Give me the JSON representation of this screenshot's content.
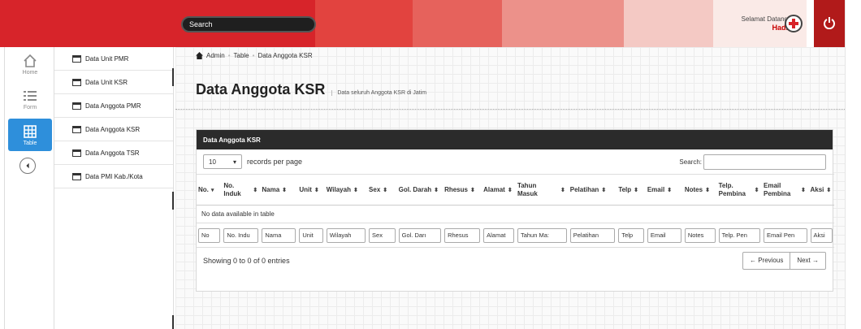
{
  "header": {
    "search_label": "Search",
    "welcome_text": "Selamat Datang",
    "user_name": "Hadi",
    "power_icon": "power-icon",
    "logo_icon": "red-cross-logo-icon"
  },
  "left_nav": {
    "items": [
      {
        "label": "Home",
        "icon": "home-icon"
      },
      {
        "label": "Form",
        "icon": "list-icon"
      },
      {
        "label": "Table",
        "icon": "table-grid-icon"
      }
    ],
    "collapse_icon": "chevron-left-icon"
  },
  "submenu": {
    "items": [
      {
        "label": "Data Unit PMR"
      },
      {
        "label": "Data Unit KSR"
      },
      {
        "label": "Data Anggota PMR"
      },
      {
        "label": "Data Anggota KSR"
      },
      {
        "label": "Data Anggota TSR"
      },
      {
        "label": "Data PMI Kab./Kota"
      }
    ]
  },
  "breadcrumb": {
    "items": [
      "Admin",
      "Table",
      "Data Anggota KSR"
    ]
  },
  "page": {
    "title": "Data Anggota KSR",
    "subtitle": "Data seluruh Anggota KSR di Jatim"
  },
  "panel": {
    "title": "Data Anggota KSR",
    "length_value": "10",
    "length_label": "records per page",
    "search_label": "Search:",
    "columns": [
      "No.",
      "No. Induk",
      "Nama",
      "Unit",
      "Wilayah",
      "Sex",
      "Gol. Darah",
      "Rhesus",
      "Alamat",
      "Tahun Masuk",
      "Pelatihan",
      "Telp",
      "Email",
      "Notes",
      "Telp. Pembina",
      "Email Pembina",
      "Aksi"
    ],
    "empty_text": "No data available in table",
    "filters": [
      "No",
      "No. Indu",
      "Nama",
      "Unit",
      "Wilayah",
      "Sex",
      "Gol. Darı",
      "Rhesus",
      "Alamat",
      "Tahun Ma:",
      "Pelatihan",
      "Telp",
      "Email",
      "Notes",
      "Telp. Pen",
      "Email Pen",
      "Aksi"
    ],
    "info_text": "Showing 0 to 0 of 0 entries",
    "prev_label": "← Previous",
    "next_label": "Next →"
  }
}
